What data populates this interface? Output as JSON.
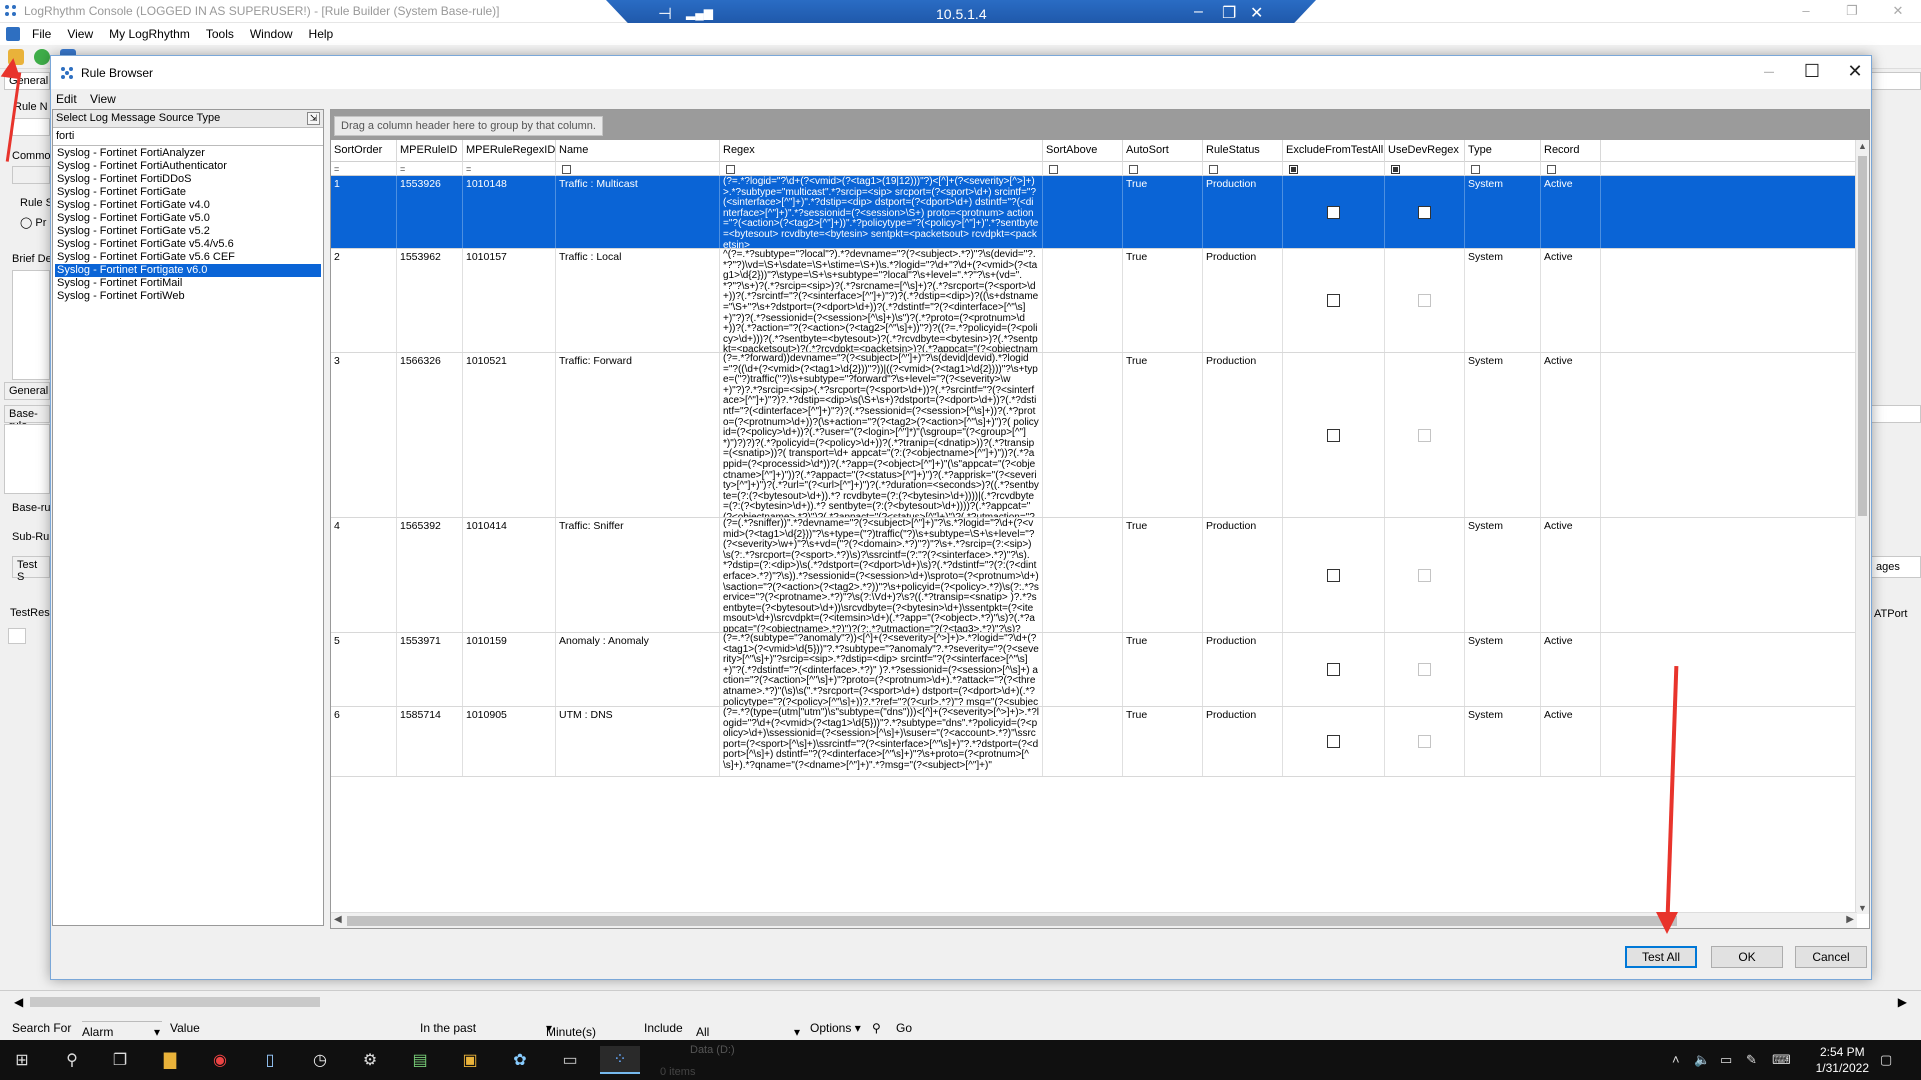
{
  "console": {
    "title": "LogRhythm Console  (LOGGED IN AS SUPERUSER!) - [Rule Builder (System Base-rule)]",
    "menu": [
      "File",
      "View",
      "My LogRhythm",
      "Tools",
      "Window",
      "Help"
    ],
    "min": "–",
    "max": "❐",
    "close": "✕"
  },
  "rdp": {
    "ip": "10.5.1.4",
    "pin": "⊣",
    "signal": "▂▄▆",
    "min": "–",
    "restore": "❐",
    "close": "✕"
  },
  "background_panel": {
    "tab_general": "General",
    "rule_name_label": "Rule N",
    "common_label": "Commor",
    "rule_s_label": "Rule S",
    "radio_label": "Pr",
    "brief_label": "Brief De",
    "general2": "General",
    "base_rule": "Base-rule",
    "base_ru": "Base-ru",
    "sub_ru": "Sub-Ru",
    "test_btn": "Test S",
    "test_res": "TestRes",
    "right_pages": "ages",
    "right_atport": "ATPort"
  },
  "dialog": {
    "title": "Rule Browser",
    "menu": [
      "Edit",
      "View"
    ],
    "min": "–",
    "max": "☐",
    "close": "✕",
    "buttons": {
      "test_all": "Test All",
      "ok": "OK",
      "cancel": "Cancel"
    }
  },
  "source_panel": {
    "header": "Select Log Message Source Type",
    "filter": "forti",
    "items": [
      "Syslog - Fortinet FortiAnalyzer",
      "Syslog - Fortinet FortiAuthenticator",
      "Syslog - Fortinet FortiDDoS",
      "Syslog - Fortinet FortiGate",
      "Syslog - Fortinet FortiGate v4.0",
      "Syslog - Fortinet FortiGate v5.0",
      "Syslog - Fortinet FortiGate v5.2",
      "Syslog - Fortinet FortiGate v5.4/v5.6",
      "Syslog - Fortinet FortiGate v5.6 CEF",
      "Syslog - Fortinet Fortigate v6.0",
      "Syslog - Fortinet FortiMail",
      "Syslog - Fortinet FortiWeb"
    ],
    "selected_index": 9
  },
  "grid": {
    "group_hint": "Drag a column header here to group by that column.",
    "columns": [
      "SortOrder",
      "MPERuleID",
      "MPERuleRegexID",
      "Name",
      "Regex",
      "SortAbove",
      "AutoSort",
      "RuleStatus",
      "ExcludeFromTestAll",
      "UseDevRegex",
      "Type",
      "Record"
    ],
    "filter_eq": "=",
    "rows": [
      {
        "sort": "1",
        "rule_id": "1553926",
        "regex_id": "1010148",
        "name": "Traffic : Multicast",
        "regex": "(?=.*?logid=\"?\\d+(?<vmid>(?<tag1>(19|12)))\"?)<[^]+(?<severity>[^>]+)>.*?subtype=\"multicast\".*?srcip=<sip> srcport=(?<sport>\\d+) srcintf=\"?(<sinterface>[^\"]+)\".*?dstip=<dip> dstport=(?<dport>\\d+) dstintf=\"?(<dinterface>[^\"]+)\".*?sessionid=(?<session>\\S+) proto=<protnum> action=\"?(<action>(?<tag2>[^\"]+))\".*?policytype=\"?(<policy>[^\"]+)\".*?sentbyte=<bytesout> rcvdbyte=<bytesin> sentpkt=<packetsout> rcvdpkt=<packetsin>",
        "sort_above": "",
        "autosort": "True",
        "status": "Production",
        "type": "System",
        "record": "Active"
      },
      {
        "sort": "2",
        "rule_id": "1553962",
        "regex_id": "1010157",
        "name": "Traffic : Local",
        "regex": "^(?=.*?subtype=\"?local\"?).*?devname=\"?(?<subject>.*?)\"?\\s(devid=\"?.*?\"?)\\vd=\\S+\\sdate=\\S+\\stime=\\S+)\\s.*?logid=\"?\\d+\"?\\d+(?<vmid>(?<tag1>\\d{2}))\"?\\stype=\\S+\\s+subtype=\"?local\"?\\s+level=\".*?\"?\\s+(vd=\".*?\"?\\s+)?(.*?srcip=<sip>)?(.*?srcname=[^\\s]+)?(.*?srcport=(?<sport>\\d+))?(.*?srcintf=\"?(?<sinterface>[^\"]+)\"?)?(.*?dstip=<dip>)?((\\s+dstname=\"\\S+\"?\\s+?dstport=(?<dport>\\d+))?(.*?dstintf=\"?(?<dinterface>[^\"\\s]+)\"?)?(.*?sessionid=(?<session>[^\\s]+)\\s\")?(.*?proto=(?<protnum>\\d+))?(.*?action=\"?(?<action>(?<tag2>[^\"\\s]+))\"?)?((?=.*?policyid=(?<policy>\\d+)))?(.*?sentbyte=<bytesout>)?(.*?rcvdbyte=<bytesin>)?(.*?sentpkt=<packetsout>)?(.*?rcvdpkt=<packetsin>)?(.*?appcat=\"(?<objectname>.*?)\"?)?",
        "sort_above": "",
        "autosort": "True",
        "status": "Production",
        "type": "System",
        "record": "Active"
      },
      {
        "sort": "3",
        "rule_id": "1566326",
        "regex_id": "1010521",
        "name": "Traffic: Forward",
        "regex": "(?=.*?forward))devname=\"?(?<subject>[^\"]+)\"?\\s(devid|devid).*?logid=\"?((\\d+(?<vmid>(?<tag1>\\d{2}))\"?))|((?<vmid>(?<tag1>\\d{2})))\"?\\s+type=(\"?)traffic(\"?)\\s+subtype=\"?forward\"?\\s+level=\"?(?<severity>\\w+)\"?)?.*?srcip=<sip>(.*?srcport=(?<sport>\\d+))?(.*?srcintf=\"?(?<sinterface>[^\"]+)\"?)?.*?dstip=<dip>\\s(\\S+\\s+)?dstport=(?<dport>\\d+))?(.*?dstintf=\"?(<dinterface>[^\"]+)\"?)?(.*?sessionid=(?<session>[^\\s]+))?(.*?proto=(?<protnum>\\d+))?(\\s+action=\"?(?<tag2>(?<action>[^\"\\s]+)\")?( policyid=(?<policy>\\d+))?(.*?user=\"(?<login>[^\"]*)\"(\\sgroup=\"(?<group>[^\"]*)\")?)?)?(.*?policyid=(?<policy>\\d+))?(.*?tranip=(<dnatip>))?(.*?transip=(<snatip>))?( transport=\\d+ appcat=\"(?:(?<objectname>[^\"]+)\"))?(.*?appid=(?<processid>\\d*))?(.*?app=(?<object>[^\"]+)\"(\\s\"appcat=\"(?<objectname>[^\"]+)\"))?(.*?appact=\"(?<status>[^\"]+)\")?(.*?apprisk=\"(?<severity>[^\"]+)\")?(.*?url=\"(?<url>[^\"]+)\")?(.*?duration=<seconds>)?((.*?sentbyte=(?:(?<bytesout>\\d+)).*? rcvdbyte=(?:(?<bytesin>\\d+))))|(.*?rcvdbyte=(?:(?<bytesin>\\d+)).*? sentbyte=(?:(?<bytesout>\\d+))))?(.*?appcat=\"(?<objectname>.*?)\")?(.*?appact=\"(?<status>[^\"]+)\")?(.*?utmaction=\"?(?<result>(?<tag3>.*?)\"|\\s+))?",
        "sort_above": "",
        "autosort": "True",
        "status": "Production",
        "type": "System",
        "record": "Active"
      },
      {
        "sort": "4",
        "rule_id": "1565392",
        "regex_id": "1010414",
        "name": "Traffic: Sniffer",
        "regex": "(?=(.*?sniffer))\".*?devname=\"?(?<subject>[^\"]+)\"?\\s.*?logid=\"?\\d+(?<vmid>(?<tag1>\\d{2}))\"?\\s+type=(\"?)traffic(\"?)\\s+subtype=\\S+\\s+level=\"?(?<severity>\\w+)\"?\\s+vd=(\"?(?<domain>.*?)\"?)\"?\\s+.*?srcip=(?:<sip>)\\s(?:.*?srcport=(?<sport>.*?)\\s)?\\ssrcintf=(?:\"?(?<sinterface>.*?)\"?\\s).*?dstip=(?:<dip>)\\s(.*?dstport=(?<dport>\\d+)\\s)?(.*?dstintf=\"?(?:(?<dinterface>.*?)\"?\\s)).*?sessionid=(?<session>\\d+)\\sproto=(?<protnum>\\d+)\\saction=\"?(?<action>(?<tag2>.*?))\"?\\s+policyid=(?<policy>.*?)\\s(?:.*?service=\"?(?<protname>.*?)\"?\\s(?:\\Vd+)?\\s?((.*?transip=<snatip> )?.*?sentbyte=(?<bytesout>\\d+))\\srcvdbyte=(?<bytesin>\\d+)\\ssentpkt=(?<itemsout>\\d+)\\srcvdpkt=(?<itemsin>\\d+)(.*?app=\"(?<object>.*?)\"\\s)?(.*?appcat=\"(?<objectname>.*?)\")?(?:.*?utmaction=\"?(?<tag3>.*?)\"?\\s)?",
        "sort_above": "",
        "autosort": "True",
        "status": "Production",
        "type": "System",
        "record": "Active"
      },
      {
        "sort": "5",
        "rule_id": "1553971",
        "regex_id": "1010159",
        "name": "Anomaly : Anomaly",
        "regex": "(?=.*?(subtype=\"?anomaly\"?))<[^]+(?<severity>[^>]+)>.*?logid=\"?\\d+(?<tag1>(?<vmid>\\d{5}))\"?.*?subtype=\"?anomaly\"?.*?severity=\"?(?<severity>[^\"\\s]+)\"?srcip=<sip>.*?dstip=<dip> srcintf=\"?(?<sinterface>[^\"\\s]+)\"?(.*?dstintf=\"?(<dinterface>.*?)\" )?.*?sessionid=(?<session>[^\\s]+) action=\"?(?<action>[^\"\\s]+)\"?proto=(?<protnum>\\d+).*?attack=\"?(?<threatname>.*?)\"(\\s)\\s(\".*?srcport=(?<sport>\\d+) dstport=(?<dport>\\d+)(.*?policytype=\"?(?<policy>[^\"\\s]+))?.*?ref=\"?(?<url>.*?)\"? msg=\"(?<subject>[^\"]+)\"",
        "sort_above": "",
        "autosort": "True",
        "status": "Production",
        "type": "System",
        "record": "Active"
      },
      {
        "sort": "6",
        "rule_id": "1585714",
        "regex_id": "1010905",
        "name": "UTM : DNS",
        "regex": "(?=.*?(type=(utm|\"utm\")\\s\"subtype=(\"dns\")))<[^]+(?<severity>[^>]+)>.*?logid=\"?\\d+(?<vmid>(?<tag1>\\d{5}))\"?.*?subtype=\"dns\".*?policyid=(?<policy>\\d+)\\ssessionid=(?<session>[^\\s]+)\\suser=\"(?<account>.*?)\"\\ssrcport=(?<sport>[^\\s]+)\\ssrcintf=\"?(?<sinterface>[^\"\\s]+)\"?.*?dstport=(?<dport>[^\\s]+) dstintf=\"?(?<dinterface>[^\"\\s]+)\"?\\s+proto=(?<protnum>[^\\s]+).*?qname=\"(?<dname>[^\"]+)\".*?msg=\"(?<subject>[^\"]+)\"",
        "sort_above": "",
        "autosort": "True",
        "status": "Production",
        "type": "System",
        "record": "Active"
      }
    ]
  },
  "search_bar": {
    "search_for": "Search For",
    "search_value": "Alarm",
    "value_label": "Value",
    "in_the_past": "In the past",
    "minutes": "Minute(s)",
    "include": "Include",
    "include_value": "All",
    "options": "Options ▾",
    "go": "Go"
  },
  "taskbar": {
    "time": "2:54 PM",
    "date": "1/31/2022",
    "data_label": "Data (D:)",
    "items_label": "0 items"
  },
  "colors": {
    "accent": "#0a64d6",
    "arrow": "#e8342c",
    "rdp": "#1c53a3",
    "taskbar": "#101010"
  }
}
